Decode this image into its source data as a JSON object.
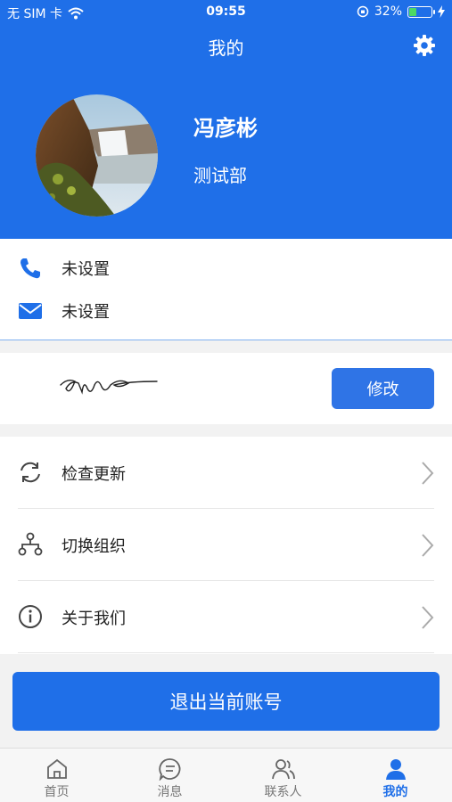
{
  "status_bar": {
    "carrier": "无 SIM 卡",
    "time": "09:55",
    "battery": "32%"
  },
  "header": {
    "title": "我的"
  },
  "profile": {
    "name": "冯彦彬",
    "department": "测试部"
  },
  "contact": {
    "phone": "未设置",
    "email": "未设置"
  },
  "signature": {
    "edit_label": "修改"
  },
  "menu": [
    {
      "label": "检查更新",
      "icon": "refresh-icon"
    },
    {
      "label": "切换组织",
      "icon": "org-switch-icon"
    },
    {
      "label": "关于我们",
      "icon": "info-icon"
    }
  ],
  "logout_label": "退出当前账号",
  "tabs": [
    {
      "label": "首页",
      "icon": "home-icon"
    },
    {
      "label": "消息",
      "icon": "message-icon"
    },
    {
      "label": "联系人",
      "icon": "contacts-icon"
    },
    {
      "label": "我的",
      "icon": "profile-icon",
      "active": true
    }
  ],
  "colors": {
    "primary": "#1f6fe8",
    "button": "#2f74e6",
    "battery": "#4cd964"
  }
}
